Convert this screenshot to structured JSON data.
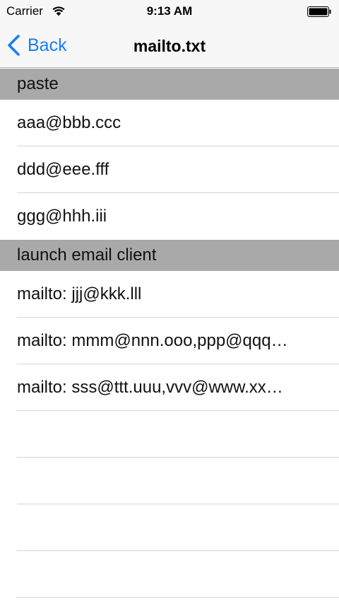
{
  "status_bar": {
    "carrier": "Carrier",
    "time": "9:13 AM",
    "wifi_icon": "wifi-icon",
    "battery_icon": "battery-icon"
  },
  "nav": {
    "back_label": "Back",
    "title": "mailto.txt",
    "accent_color": "#1a7cf4"
  },
  "sections": [
    {
      "header": "paste",
      "rows": [
        "aaa@bbb.ccc",
        "ddd@eee.fff",
        "ggg@hhh.iii"
      ]
    },
    {
      "header": "launch email client",
      "rows": [
        "mailto: jjj@kkk.lll",
        "mailto: mmm@nnn.ooo,ppp@qqq…",
        "mailto: sss@ttt.uuu,vvv@www.xx…"
      ]
    }
  ]
}
